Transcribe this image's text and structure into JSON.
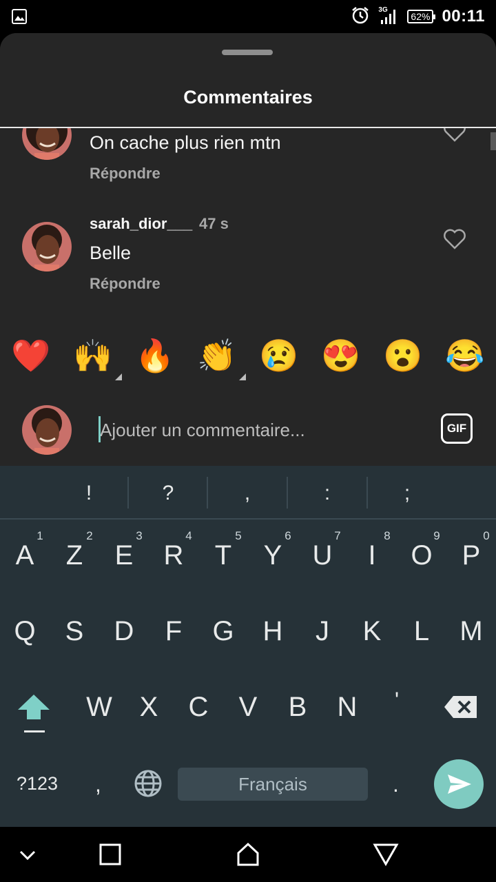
{
  "status_bar": {
    "network": "3G",
    "battery": "62%",
    "time": "00:11"
  },
  "sheet": {
    "title": "Commentaires"
  },
  "comments": [
    {
      "text": "On cache plus rien mtn",
      "reply_label": "Répondre"
    },
    {
      "username": "sarah_dior___",
      "time": "47 s",
      "text": "Belle",
      "reply_label": "Répondre"
    }
  ],
  "emoji_bar": [
    "❤️",
    "🙌",
    "🔥",
    "👏",
    "😢",
    "😍",
    "😮",
    "😂"
  ],
  "comment_input": {
    "placeholder": "Ajouter un commentaire...",
    "gif_label": "GIF"
  },
  "keyboard": {
    "suggestions": [
      "!",
      "?",
      ",",
      ":",
      ";"
    ],
    "row1": [
      "A",
      "Z",
      "E",
      "R",
      "T",
      "Y",
      "U",
      "I",
      "O",
      "P"
    ],
    "row1_hints": [
      "1",
      "2",
      "3",
      "4",
      "5",
      "6",
      "7",
      "8",
      "9",
      "0"
    ],
    "row2": [
      "Q",
      "S",
      "D",
      "F",
      "G",
      "H",
      "J",
      "K",
      "L",
      "M"
    ],
    "row3": [
      "W",
      "X",
      "C",
      "V",
      "B",
      "N",
      "'"
    ],
    "symbols_label": "?123",
    "comma": ",",
    "period": ".",
    "space_label": "Français"
  },
  "colors": {
    "sheet_bg": "#262626",
    "keyboard_bg": "#263238",
    "accent": "#7fcbc1"
  }
}
